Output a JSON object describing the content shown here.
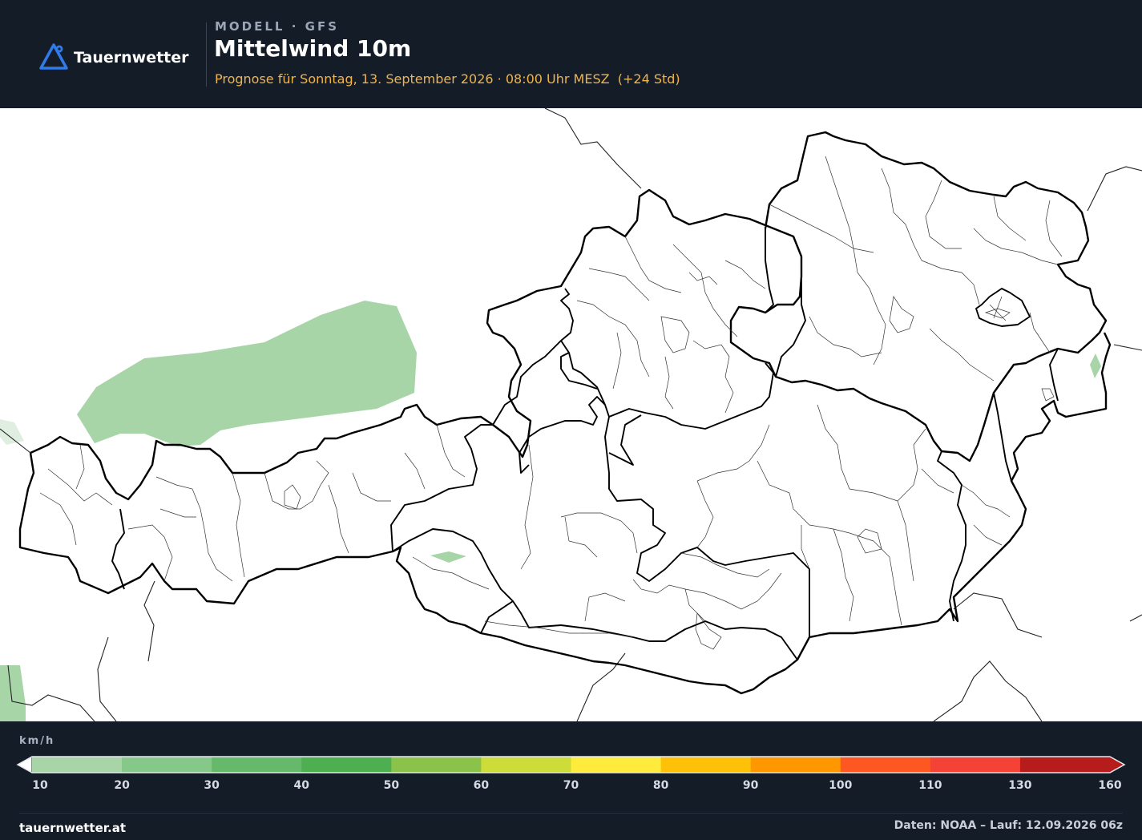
{
  "header": {
    "brand": "Tauernwetter",
    "model_label": "MODELL · GFS",
    "title": "Mittelwind 10m",
    "subtitle": "Prognose für Sonntag, 13. September 2026 · 08:00 Uhr MESZ  (+24 Std)",
    "logo_icon": "triangle-pin-icon"
  },
  "legend": {
    "unit": "km/h",
    "ticks": [
      "10",
      "20",
      "30",
      "40",
      "50",
      "60",
      "70",
      "80",
      "90",
      "100",
      "110",
      "130",
      "160"
    ],
    "colors": [
      "#a8d5a8",
      "#86c78a",
      "#66b96a",
      "#4daf50",
      "#8bc34a",
      "#cddc39",
      "#ffeb3b",
      "#ffc107",
      "#ff9800",
      "#ff5722",
      "#f44336",
      "#b71c1c"
    ],
    "under_color": "#ffffff",
    "over_color": "#b71c1c"
  },
  "footer": {
    "site": "tauernwetter.at",
    "source": "Daten: NOAA – Lauf: 12.09.2026 06z"
  },
  "colors": {
    "background": "#141c28",
    "accent": "#f0b44b",
    "logo_blue": "#2f7bea",
    "light_wind_area": "#a8d5a8"
  }
}
